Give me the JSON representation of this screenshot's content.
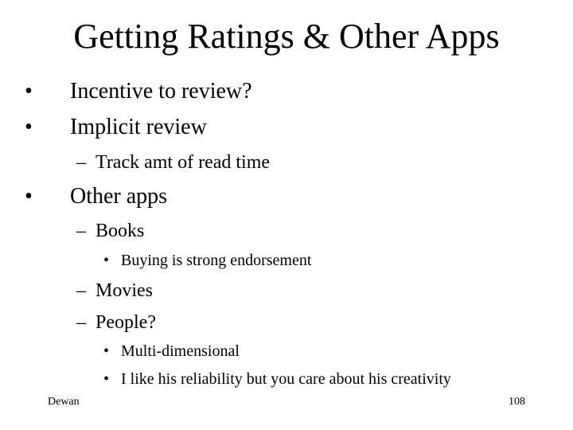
{
  "slide": {
    "title": "Getting Ratings & Other Apps",
    "bullets": [
      {
        "level": 1,
        "marker": "•",
        "text": "Incentive to review?"
      },
      {
        "level": 1,
        "marker": "•",
        "text": "Implicit review"
      },
      {
        "level": 2,
        "marker": "–",
        "text": "Track amt of read time"
      },
      {
        "level": 1,
        "marker": "•",
        "text": "Other apps"
      },
      {
        "level": 2,
        "marker": "–",
        "text": "Books"
      },
      {
        "level": 3,
        "marker": "•",
        "text": "Buying is strong endorsement"
      },
      {
        "level": 2,
        "marker": "–",
        "text": "Movies"
      },
      {
        "level": 2,
        "marker": "–",
        "text": "People?"
      },
      {
        "level": 3,
        "marker": "•",
        "text": "Multi-dimensional"
      },
      {
        "level": 3,
        "marker": "•",
        "text": "I like his reliability but you care about his creativity"
      }
    ],
    "footer": {
      "author": "Dewan",
      "page_number": "108"
    }
  }
}
